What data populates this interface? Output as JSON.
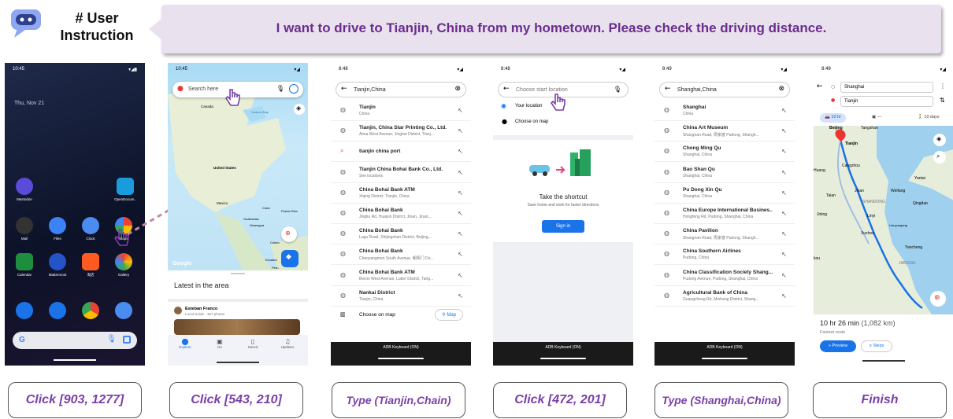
{
  "instruction": {
    "title_line1": "# User",
    "title_line2": "Instruction",
    "text": "I want to drive to Tianjin, China from my hometown. Please check the driving distance."
  },
  "colors": {
    "accent": "#7b3fa8",
    "blue": "#1a73e8",
    "purple_text": "#6b2d8e"
  },
  "actions": [
    "Click [903, 1277]",
    "Click [543, 210]",
    "Type (Tianjin,Chain)",
    "Click [472, 201]",
    "Type (Shanghai,China)",
    "Finish"
  ],
  "s1": {
    "time": "10:45",
    "date": "Thu, Nov 21",
    "apps_row1": [
      {
        "name": "Mastodon",
        "color": "#5b4bd9"
      },
      {
        "name": "OpenDocum..",
        "color": "#1a9bdc"
      }
    ],
    "apps_row2": [
      {
        "name": "Mail",
        "color": "#222"
      },
      {
        "name": "Files",
        "color": "#3b82f6"
      },
      {
        "name": "Clock",
        "color": "#4a8cf0"
      },
      {
        "name": "Maps",
        "color": "#ffffff"
      }
    ],
    "apps_row3": [
      {
        "name": "Calendar",
        "color": "#1e8e3e"
      },
      {
        "name": "Mattermost",
        "color": "#2454c8"
      },
      {
        "name": "淘店",
        "color": "#ff5a1f"
      },
      {
        "name": "Gallery",
        "color": "#f5b400"
      }
    ],
    "search_letter": "G"
  },
  "s2": {
    "time": "10:45",
    "search_placeholder": "Search here",
    "places": [
      "Canada",
      "Hudson Bay",
      "United States",
      "Mexico",
      "Cuba",
      "Puerto Rico",
      "Guatemala",
      "Nicaragua",
      "Colom.",
      "Ecuador",
      "Peru"
    ],
    "google": "Google",
    "latest": "Latest in the area",
    "user": "Esteban Franco",
    "user_sub": "Local Guide · 367 photos",
    "nav": [
      "Explore",
      "Go",
      "Saved",
      "Updates"
    ]
  },
  "s3": {
    "time": "8:48",
    "query": "Tianjin,China",
    "results": [
      {
        "t1": "Tianjin",
        "t2": "China"
      },
      {
        "t1": "Tianjin, China Star Printing Co., Ltd.",
        "t2": "Aima West Avenue, Jinghai District, Tianj..."
      },
      {
        "t1": "tianjin china port",
        "t2": ""
      },
      {
        "t1": "Tianjin China Bohai Bank Co., Ltd.",
        "t2": "See locations"
      },
      {
        "t1": "China Bohai Bank ATM",
        "t2": "Xiqing District, Tianjin, China"
      },
      {
        "t1": "China Bohai Bank",
        "t2": "Jingliu Rd, Huaiyin District, Jinan, Jinan,..."
      },
      {
        "t1": "China Bohai Bank",
        "t2": "Lugu Road, Shijingshan District, Beijing,..."
      },
      {
        "t1": "China Bohai Bank",
        "t2": "Chaoyangmen South Avenue, 朝阳门 Do..."
      },
      {
        "t1": "China Bohai Bank ATM",
        "t2": "Beixin West Avenue, Luber District, Tang..."
      },
      {
        "t1": "Nankai District",
        "t2": "Tianjin, China"
      }
    ],
    "choose_map": "Choose on map",
    "map_btn": "Map",
    "kb": "ADB Keyboard (ON)"
  },
  "s4": {
    "time": "8:48",
    "placeholder": "Choose start location",
    "your_location": "Your location",
    "choose_map": "Choose on map",
    "shortcut_title": "Take the shortcut",
    "shortcut_sub": "Save home and work for faster directions",
    "sign_in": "Sign in",
    "kb": "ADB Keyboard (ON)"
  },
  "s5": {
    "time": "8:49",
    "query": "Shanghai,China",
    "results": [
      {
        "t1": "Shanghai",
        "t2": "China"
      },
      {
        "t1": "China Art Museum",
        "t2": "Shangnan Road, 周家渡 Pudong, Shangh..."
      },
      {
        "t1": "Chong Ming Qu",
        "t2": "Shanghai, China"
      },
      {
        "t1": "Bao Shan Qu",
        "t2": "Shanghai, China"
      },
      {
        "t1": "Pu Dong Xin Qu",
        "t2": "Shanghai, China"
      },
      {
        "t1": "China Europe International Busines..",
        "t2": "Hongfeng Rd, Pudong, Shanghai, China"
      },
      {
        "t1": "China Pavilion",
        "t2": "Shangnan Road, 周家渡 Pudong, Shangh..."
      },
      {
        "t1": "China Southern Airlines",
        "t2": "Pudong, China"
      },
      {
        "t1": "China Classification Society Shang...",
        "t2": "Pudong Avenue, Pudong, Shanghai, China"
      },
      {
        "t1": "Agricultural Bank of China",
        "t2": "Guangcheng Rd, Minhang District, Shang..."
      }
    ],
    "kb": "ADB Keyboard (ON)"
  },
  "s6": {
    "time": "8:49",
    "from": "Shanghai",
    "to": "Tianjin",
    "car_time": "10 hr",
    "walk": "10 days",
    "transit": "—",
    "places": [
      "Beijing",
      "Tangshan",
      "Tianjin",
      "Cangzhou",
      "Yantai",
      "Weifang",
      "Jinan",
      "Qingdao",
      "Linyi",
      "Lianyungang",
      "Xuzhou",
      "Yancheng",
      "JIANGSU",
      "SHANDONG",
      "Jining",
      "Taian",
      "Huang",
      "kou"
    ],
    "duration": "10 hr 26 min",
    "distance": "(1,082 km)",
    "fastest": "Fastest route",
    "preview": "Preview",
    "steps": "Steps"
  }
}
